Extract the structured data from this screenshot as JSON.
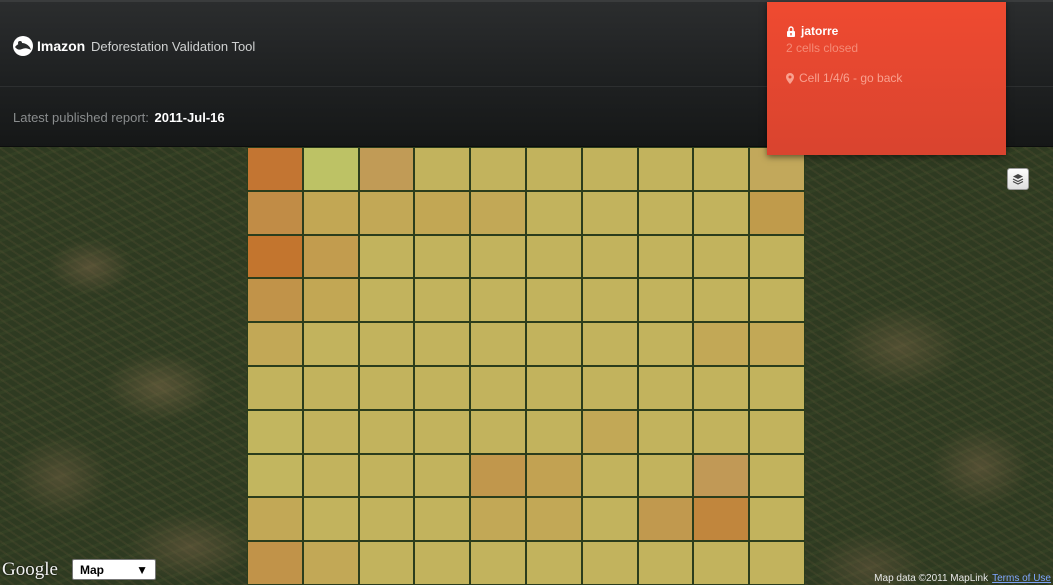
{
  "header": {
    "logo_text": "Imazon",
    "app_title": "Deforestation Validation Tool"
  },
  "report": {
    "label": "Latest published report:",
    "date": "2011-Jul-16"
  },
  "user_panel": {
    "username": "jatorre",
    "cells_closed": "2 cells closed",
    "cell_nav": "Cell 1/4/6 - go back",
    "background": "#e84830"
  },
  "map": {
    "map_type_selected": "Map",
    "google_logo": "Google",
    "attribution": "Map data ©2011 MapLink",
    "terms_link": "Terms of Use",
    "grid_colors": [
      [
        "#cf7a34",
        "#c8cc6a",
        "#cca35a",
        "#cdbc62",
        "#cdbc62",
        "#cdbc62",
        "#cdbc62",
        "#cdbc62",
        "#cdbc62",
        "#cdb060"
      ],
      [
        "#cc9249",
        "#cdaf58",
        "#cdb05a",
        "#cdaf58",
        "#cdb05a",
        "#cdbc62",
        "#cdbc62",
        "#cdbc62",
        "#cdbc62",
        "#cba24f"
      ],
      [
        "#cf7a2f",
        "#cda452",
        "#cdbc62",
        "#cdbc62",
        "#cdbc62",
        "#cdbc62",
        "#cdbc62",
        "#cdbc62",
        "#cdbc62",
        "#cdbc62"
      ],
      [
        "#cc9a4c",
        "#cdaf58",
        "#cdbc62",
        "#cdbc62",
        "#cdbc62",
        "#cdbc62",
        "#cdbc62",
        "#cdbc62",
        "#cdbc62",
        "#cdbc62"
      ],
      [
        "#cdb05a",
        "#cdbc62",
        "#cdbc62",
        "#cdbc62",
        "#cdbc62",
        "#cdbc62",
        "#cdbc62",
        "#cdbc62",
        "#cdb05a",
        "#cdb05a"
      ],
      [
        "#cdbc62",
        "#cdbc62",
        "#cdbc62",
        "#cdbc62",
        "#cdbc62",
        "#cdbc62",
        "#cdbc62",
        "#cdbc62",
        "#cdbc62",
        "#cdbc62"
      ],
      [
        "#cdc064",
        "#cdbc62",
        "#cdbc62",
        "#cdbc62",
        "#cdbc62",
        "#cdbc62",
        "#cdb05a",
        "#cdbc62",
        "#cdbc62",
        "#cdbc62"
      ],
      [
        "#cdc064",
        "#cdbc62",
        "#cdbc62",
        "#cdbc62",
        "#cc9e50",
        "#cdaa56",
        "#cdbc62",
        "#cdbc62",
        "#cca05a",
        "#cdbc62"
      ],
      [
        "#cdb05a",
        "#cdbc62",
        "#cdbc62",
        "#cdbc62",
        "#cdb05a",
        "#cdb05a",
        "#cdbc62",
        "#cca052",
        "#cc8c3f",
        "#cdbc62"
      ],
      [
        "#cc9a4c",
        "#cdb05a",
        "#cdbc62",
        "#cdbc62",
        "#cdbc62",
        "#cdbc62",
        "#cdbc62",
        "#cdbc62",
        "#cdbc62",
        "#cdbc62"
      ]
    ]
  }
}
